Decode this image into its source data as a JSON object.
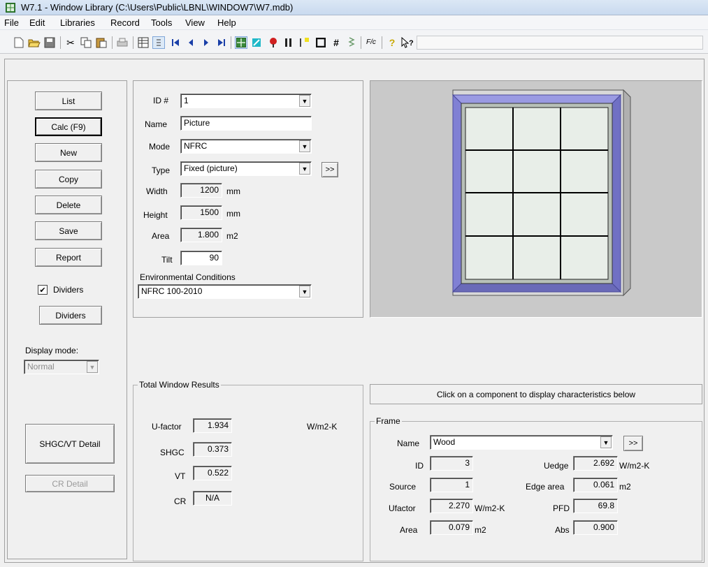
{
  "window": {
    "title": "W7.1 - Window Library (C:\\Users\\Public\\LBNL\\WINDOW7\\W7.mdb)"
  },
  "menu": [
    "File",
    "Edit",
    "Libraries",
    "Record",
    "Tools",
    "View",
    "Help"
  ],
  "toolbar": {
    "icons": [
      "new-icon",
      "open-icon",
      "save-icon",
      "cut-icon",
      "copy-icon",
      "paste-icon",
      "print-icon",
      "list-view-icon",
      "detail-view-icon",
      "first-record-icon",
      "previous-record-icon",
      "next-record-icon",
      "last-record-icon",
      "window-icon",
      "glazing-icon",
      "gas-icon",
      "frame-icon",
      "divider-icon",
      "shading-icon",
      "grid-icon",
      "spacer-icon",
      "calc-icon",
      "help-icon",
      "context-help-icon"
    ],
    "calc_glyph": "F/c"
  },
  "left_buttons": {
    "list": "List",
    "calc": "Calc (F9)",
    "new": "New",
    "copy": "Copy",
    "delete": "Delete",
    "save": "Save",
    "report": "Report",
    "dividers_check_label": "Dividers",
    "dividers_button": "Dividers",
    "display_mode_label": "Display mode:",
    "display_mode_value": "Normal",
    "shgc_vt_detail": "SHGC/VT Detail",
    "cr_detail": "CR Detail"
  },
  "record": {
    "id_label": "ID #",
    "id_value": "1",
    "name_label": "Name",
    "name_value": "Picture",
    "mode_label": "Mode",
    "mode_value": "NFRC",
    "type_label": "Type",
    "type_value": "Fixed (picture)",
    "type_more": ">>",
    "width_label": "Width",
    "width_value": "1200",
    "width_unit": "mm",
    "height_label": "Height",
    "height_value": "1500",
    "height_unit": "mm",
    "area_label": "Area",
    "area_value": "1.800",
    "area_unit": "m2",
    "tilt_label": "Tilt",
    "tilt_value": "90",
    "env_label": "Environmental Conditions",
    "env_value": "NFRC 100-2010"
  },
  "results": {
    "legend": "Total Window Results",
    "ufactor_label": "U-factor",
    "ufactor_value": "1.934",
    "ufactor_unit": "W/m2-K",
    "shgc_label": "SHGC",
    "shgc_value": "0.373",
    "vt_label": "VT",
    "vt_value": "0.522",
    "cr_label": "CR",
    "cr_value": "N/A"
  },
  "hint": "Click on a component to display characteristics below",
  "frame": {
    "legend": "Frame",
    "name_label": "Name",
    "name_value": "Wood",
    "more": ">>",
    "id_label": "ID",
    "id_value": "3",
    "source_label": "Source",
    "source_value": "1",
    "ufactor_label": "Ufactor",
    "ufactor_value": "2.270",
    "ufactor_unit": "W/m2-K",
    "area_label": "Area",
    "area_value": "0.079",
    "area_unit": "m2",
    "uedge_label": "Uedge",
    "uedge_value": "2.692",
    "uedge_unit": "W/m2-K",
    "edge_area_label": "Edge area",
    "edge_area_value": "0.061",
    "edge_area_unit": "m2",
    "pfd_label": "PFD",
    "pfd_value": "69.8",
    "abs_label": "Abs",
    "abs_value": "0.900"
  },
  "colors": {
    "frame_fill": "#8a8ad8",
    "frame_edge": "#5a5aa8",
    "glass": "#e8eee8",
    "grid": "#000000",
    "preview_bg": "#c9c9c9"
  }
}
